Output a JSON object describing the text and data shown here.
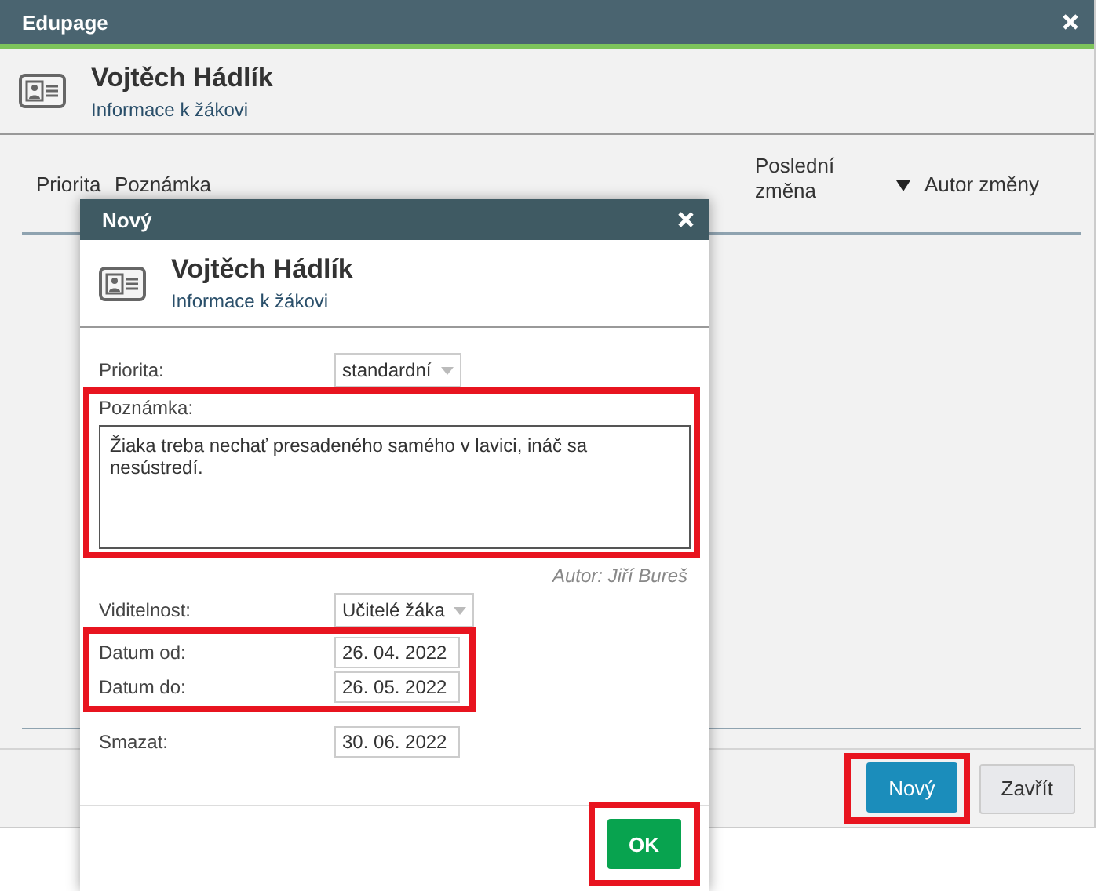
{
  "window": {
    "title": "Edupage",
    "header": {
      "name": "Vojtěch Hádlík",
      "subtitle": "Informace k žákovi"
    },
    "table": {
      "columns": [
        {
          "label": "Priorita",
          "sorted": false
        },
        {
          "label": "Poznámka",
          "sorted": false
        },
        {
          "label": "Poslední změna",
          "sorted": true
        },
        {
          "label": "Autor změny",
          "sorted": false
        }
      ]
    },
    "buttons": [
      {
        "label": "Nový",
        "kind": "primary",
        "highlighted": true
      },
      {
        "label": "Zavřít",
        "kind": "secondary",
        "highlighted": false
      }
    ]
  },
  "dialog": {
    "title": "Nový",
    "header": {
      "name": "Vojtěch Hádlík",
      "subtitle": "Informace k žákovi"
    },
    "sections": [
      {
        "highlighted": false,
        "fields": [
          {
            "kind": "select",
            "label": "Priorita:",
            "value": "standardní"
          }
        ]
      },
      {
        "highlighted": true,
        "fields": [
          {
            "kind": "textarea",
            "label": "Poznámka:",
            "value": "Žiaka treba nechať presadeného samého v lavici, ináč sa nesústredí.",
            "author": "Autor: Jiří Bureš"
          }
        ]
      },
      {
        "highlighted": false,
        "fields": [
          {
            "kind": "select",
            "label": "Viditelnost:",
            "value": "Učitelé žáka"
          }
        ]
      },
      {
        "highlighted": true,
        "fields": [
          {
            "kind": "date",
            "label": "Datum od:",
            "value": "26. 04. 2022"
          },
          {
            "kind": "date",
            "label": "Datum do:",
            "value": "26. 05. 2022"
          }
        ]
      },
      {
        "highlighted": false,
        "fields": [
          {
            "kind": "date",
            "label": "Smazat:",
            "value": "30. 06. 2022"
          }
        ]
      }
    ],
    "buttons": [
      {
        "label": "OK",
        "kind": "confirm",
        "highlighted": true
      }
    ]
  }
}
